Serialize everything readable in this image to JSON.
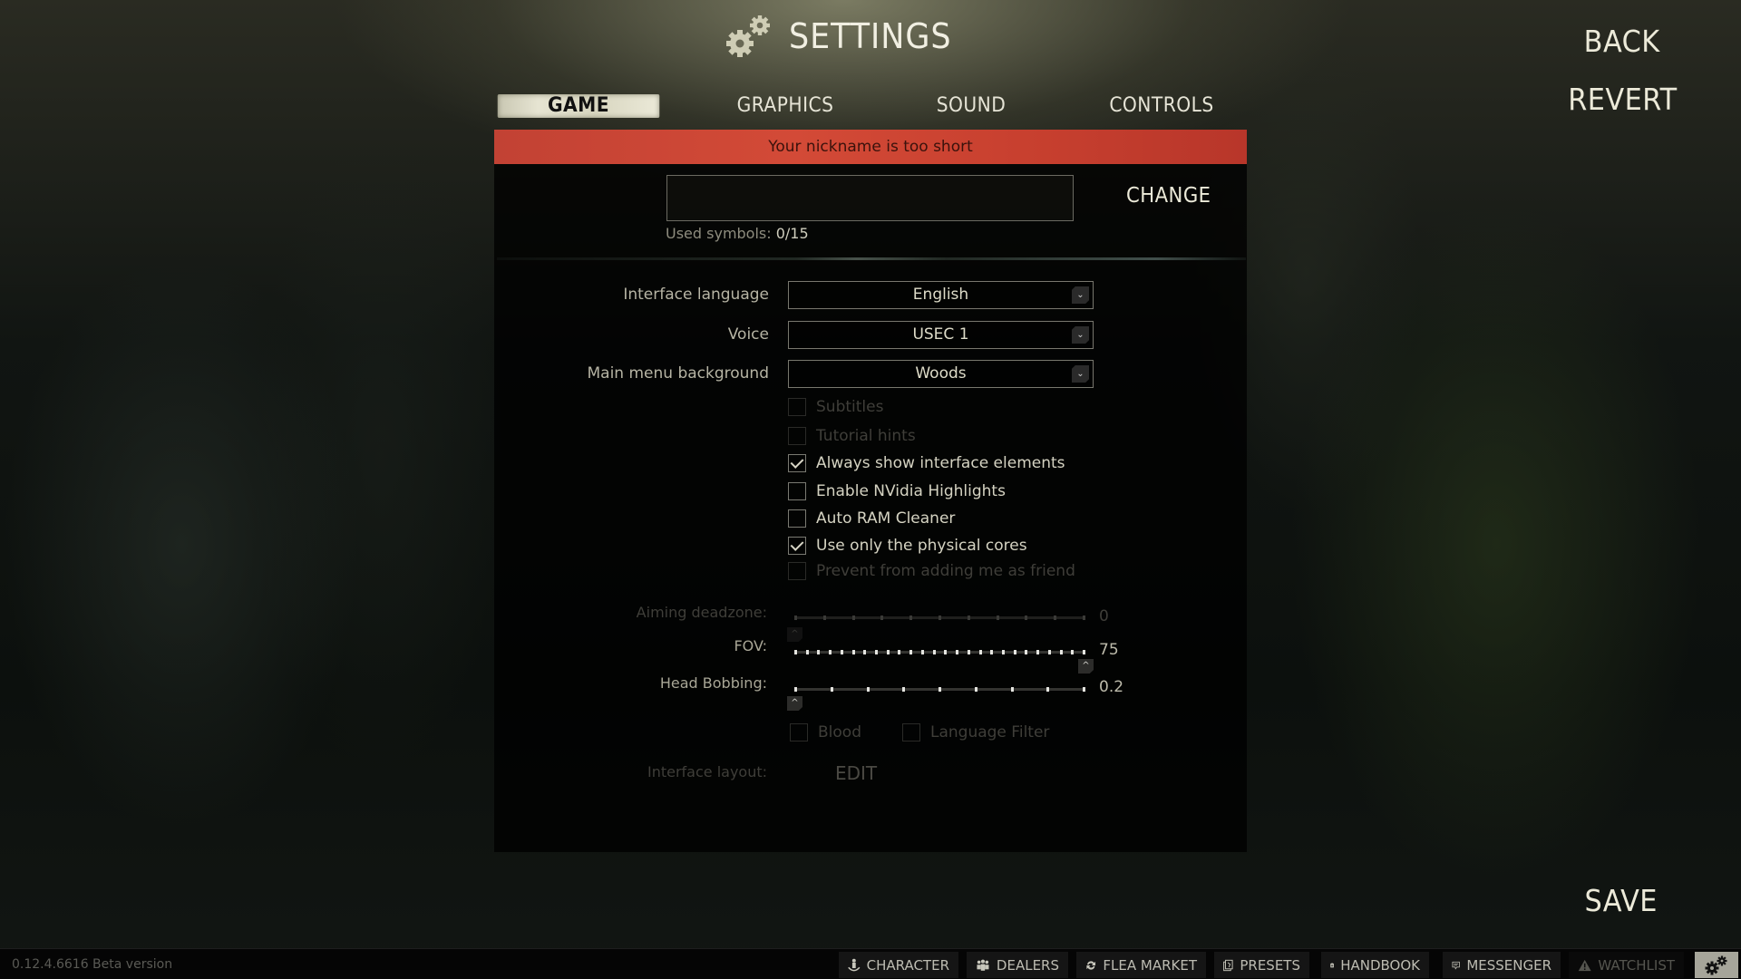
{
  "header": {
    "title": "SETTINGS",
    "icon": "gears-icon"
  },
  "tabs": [
    {
      "label": "GAME",
      "active": true
    },
    {
      "label": "GRAPHICS",
      "active": false
    },
    {
      "label": "SOUND",
      "active": false
    },
    {
      "label": "CONTROLS",
      "active": false
    }
  ],
  "side_buttons": {
    "back": "BACK",
    "revert": "REVERT",
    "save": "SAVE"
  },
  "nickname": {
    "error": "Your nickname is too short",
    "value": "",
    "placeholder": "",
    "change_label": "CHANGE",
    "used_symbols_label": "Used symbols:",
    "used_symbols_value": "0/15"
  },
  "dropdowns": [
    {
      "label": "Interface language",
      "value": "English"
    },
    {
      "label": "Voice",
      "value": "USEC 1"
    },
    {
      "label": "Main menu background",
      "value": "Woods"
    }
  ],
  "checkboxes": [
    {
      "label": "Subtitles",
      "checked": false,
      "enabled": false
    },
    {
      "label": "Tutorial hints",
      "checked": false,
      "enabled": false
    },
    {
      "label": "Always show interface elements",
      "checked": true,
      "enabled": true
    },
    {
      "label": "Enable NVidia Highlights",
      "checked": false,
      "enabled": true
    },
    {
      "label": "Auto RAM Cleaner",
      "checked": false,
      "enabled": true
    },
    {
      "label": "Use only the physical cores",
      "checked": true,
      "enabled": true
    },
    {
      "label": "Prevent from adding me as friend",
      "checked": false,
      "enabled": false
    }
  ],
  "sliders": [
    {
      "label": "Aiming deadzone:",
      "value": "0",
      "fraction": 0.0,
      "ticks": 11,
      "enabled": false
    },
    {
      "label": "FOV:",
      "value": "75",
      "fraction": 1.0,
      "ticks": 26,
      "enabled": true
    },
    {
      "label": "Head Bobbing:",
      "value": "0.2",
      "fraction": 0.0,
      "ticks": 9,
      "enabled": true
    }
  ],
  "bottom_checkboxes": [
    {
      "label": "Blood",
      "checked": false,
      "enabled": false
    },
    {
      "label": "Language Filter",
      "checked": false,
      "enabled": false
    }
  ],
  "interface_layout": {
    "label": "Interface layout:",
    "edit_label": "EDIT"
  },
  "footer": {
    "version": "0.12.4.6616 Beta version",
    "nav": [
      {
        "label": "CHARACTER",
        "icon": "character-icon",
        "enabled": true
      },
      {
        "label": "DEALERS",
        "icon": "dealers-icon",
        "enabled": true
      },
      {
        "label": "FLEA MARKET",
        "icon": "flea-market-icon",
        "enabled": true
      },
      {
        "label": "PRESETS",
        "icon": "presets-icon",
        "enabled": true
      },
      {
        "label": "HANDBOOK",
        "icon": "handbook-icon",
        "enabled": true
      },
      {
        "label": "MESSENGER",
        "icon": "messenger-icon",
        "enabled": true
      },
      {
        "label": "WATCHLIST",
        "icon": "warning-icon",
        "enabled": false
      }
    ],
    "settings_icon": "gears-icon"
  }
}
